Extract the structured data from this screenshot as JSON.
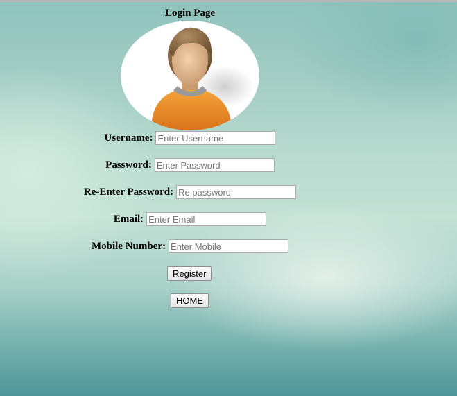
{
  "page": {
    "title": "Login Page"
  },
  "avatar": {
    "icon": "user-avatar-icon"
  },
  "form": {
    "username": {
      "label": "Username:",
      "placeholder": "Enter Username",
      "value": ""
    },
    "password": {
      "label": "Password:",
      "placeholder": "Enter Password",
      "value": ""
    },
    "repassword": {
      "label": "Re-Enter Password:",
      "placeholder": "Re password",
      "value": ""
    },
    "email": {
      "label": "Email:",
      "placeholder": "Enter Email",
      "value": ""
    },
    "mobile": {
      "label": "Mobile Number:",
      "placeholder": "Enter Mobile",
      "value": ""
    }
  },
  "buttons": {
    "register": "Register",
    "home": "HOME"
  },
  "colors": {
    "avatar_shirt": "#e8861f",
    "avatar_skin": "#d9b48e",
    "avatar_hair": "#8a6a44"
  }
}
